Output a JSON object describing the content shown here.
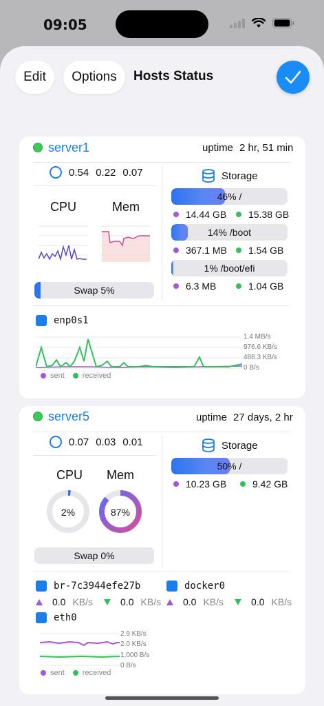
{
  "status_bar": {
    "time": "09:05"
  },
  "toolbar": {
    "edit_label": "Edit",
    "options_label": "Options",
    "title": "Hosts Status",
    "done_icon": "checkmark-icon"
  },
  "colors": {
    "accent": "#1a8cf5",
    "online": "#3cc85a",
    "sent": "#a357d6",
    "received": "#31c05a"
  },
  "servers": [
    {
      "name": "server1",
      "uptime_label": "uptime",
      "uptime_value": "2 hr, 51 min",
      "load": [
        "0.54",
        "0.22",
        "0.07"
      ],
      "cpu_label": "CPU",
      "mem_label": "Mem",
      "swap": {
        "label": "Swap 5%",
        "percent": 5
      },
      "storage": {
        "label": "Storage",
        "volumes": [
          {
            "label": "46% /",
            "percent": 46,
            "used": "14.44 GB",
            "free": "15.38 GB"
          },
          {
            "label": "14% /boot",
            "percent": 14,
            "used": "367.1 MB",
            "free": "1.54 GB"
          },
          {
            "label": "1% /boot/efi",
            "percent": 1,
            "used": "6.3 MB",
            "free": "1.04 GB"
          }
        ]
      },
      "network": {
        "interface": "enp0s1",
        "axis": [
          "1.4 MB/s",
          "976.6 KB/s",
          "488.3 KB/s",
          "0 B/s"
        ],
        "legend_sent": "sent",
        "legend_received": "received"
      }
    },
    {
      "name": "server5",
      "uptime_label": "uptime",
      "uptime_value": "27 days, 2 hr",
      "load": [
        "0.07",
        "0.03",
        "0.01"
      ],
      "cpu_label": "CPU",
      "mem_label": "Mem",
      "cpu_percent": "2%",
      "cpu_value": 2,
      "mem_percent": "87%",
      "mem_value": 87,
      "swap": {
        "label": "Swap 0%",
        "percent": 0
      },
      "storage": {
        "label": "Storage",
        "volumes": [
          {
            "label": "50% /",
            "percent": 50,
            "used": "10.23 GB",
            "free": "9.42 GB"
          }
        ]
      },
      "interfaces": [
        {
          "name": "br-7c3944efe27b",
          "sent": "0.0",
          "received": "0.0",
          "unit": "KB/s"
        },
        {
          "name": "docker0",
          "sent": "0.0",
          "received": "0.0",
          "unit": "KB/s"
        }
      ],
      "network": {
        "interface": "eth0",
        "axis": [
          "2.9 KB/s",
          "2.0 KB/s",
          "1,000 B/s",
          "0 B/s"
        ],
        "legend_sent": "sent",
        "legend_received": "received"
      }
    }
  ]
}
